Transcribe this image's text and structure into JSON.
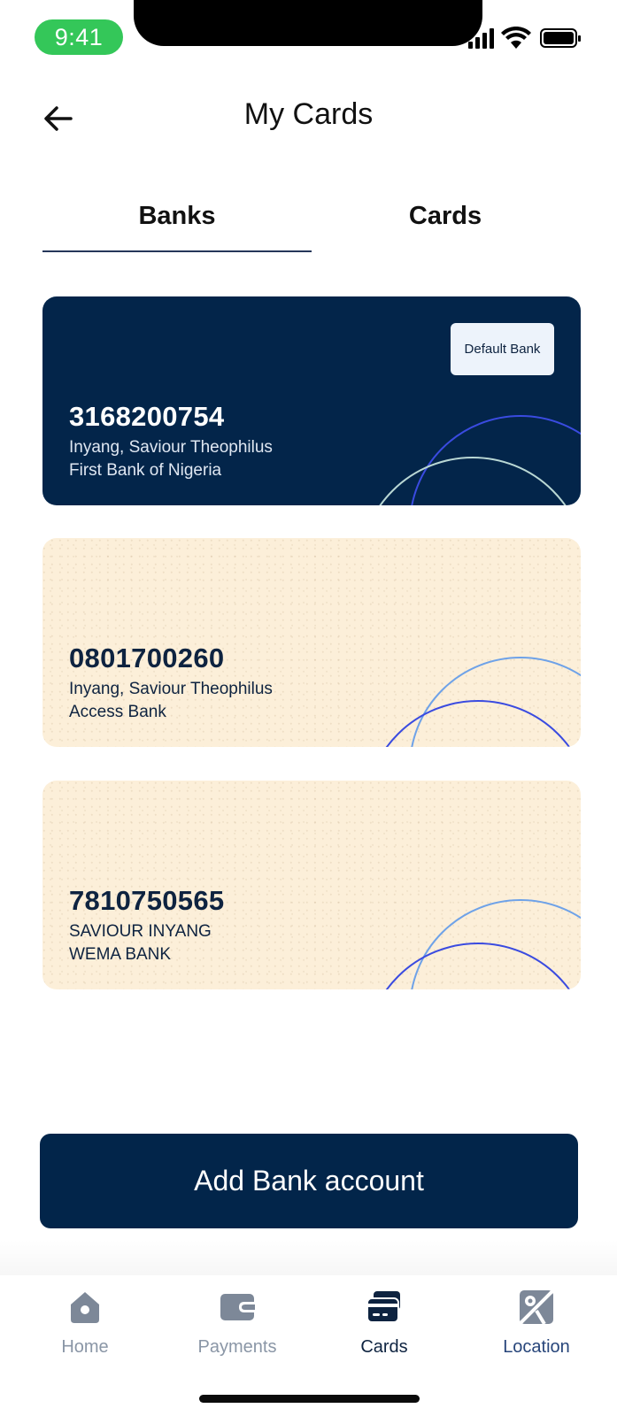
{
  "status_bar": {
    "time": "9:41"
  },
  "header": {
    "title": "My Cards"
  },
  "tabs": [
    {
      "label": "Banks",
      "active": true
    },
    {
      "label": "Cards",
      "active": false
    }
  ],
  "accounts": [
    {
      "number": "3168200754",
      "holder": "Inyang, Saviour Theophilus",
      "bank": "First Bank of Nigeria",
      "badge": "Default Bank",
      "theme": "dark"
    },
    {
      "number": "0801700260",
      "holder": "Inyang, Saviour Theophilus",
      "bank": "Access Bank",
      "theme": "light"
    },
    {
      "number": "7810750565",
      "holder": "SAVIOUR INYANG",
      "bank": "WEMA BANK",
      "theme": "light"
    }
  ],
  "primary_action": {
    "label": "Add Bank account"
  },
  "bottom_nav": [
    {
      "label": "Home",
      "icon": "home-icon"
    },
    {
      "label": "Payments",
      "icon": "wallet-icon"
    },
    {
      "label": "Cards",
      "icon": "card-icon",
      "active": true
    },
    {
      "label": "Location",
      "icon": "map-icon"
    }
  ],
  "colors": {
    "navy": "#02254a",
    "cream": "#fcefd9",
    "status_green": "#34c759",
    "arc_blue": "#3a4be0",
    "arc_light_blue": "#6ea2e8",
    "tab_underline": "#25375a",
    "nav_inactive": "#8a96a6"
  }
}
